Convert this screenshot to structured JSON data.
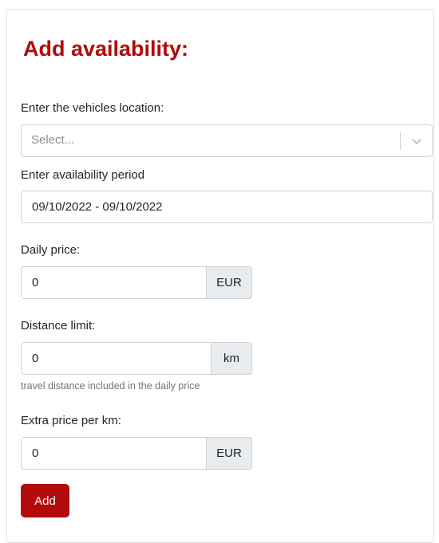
{
  "form": {
    "title": "Add availability:",
    "location": {
      "label": "Enter the vehicles location:",
      "placeholder": "Select..."
    },
    "period": {
      "label": "Enter availability period",
      "value": "09/10/2022 - 09/10/2022"
    },
    "daily_price": {
      "label": "Daily price:",
      "value": "0",
      "unit": "EUR"
    },
    "distance_limit": {
      "label": "Distance limit:",
      "value": "0",
      "unit": "km",
      "help": "travel distance included in the daily price"
    },
    "extra_price": {
      "label": "Extra price per km:",
      "value": "0",
      "unit": "EUR"
    },
    "submit_label": "Add"
  },
  "colors": {
    "accent": "#b00b0b",
    "addon_bg": "#e9ecef",
    "border": "#cfd3d8"
  }
}
